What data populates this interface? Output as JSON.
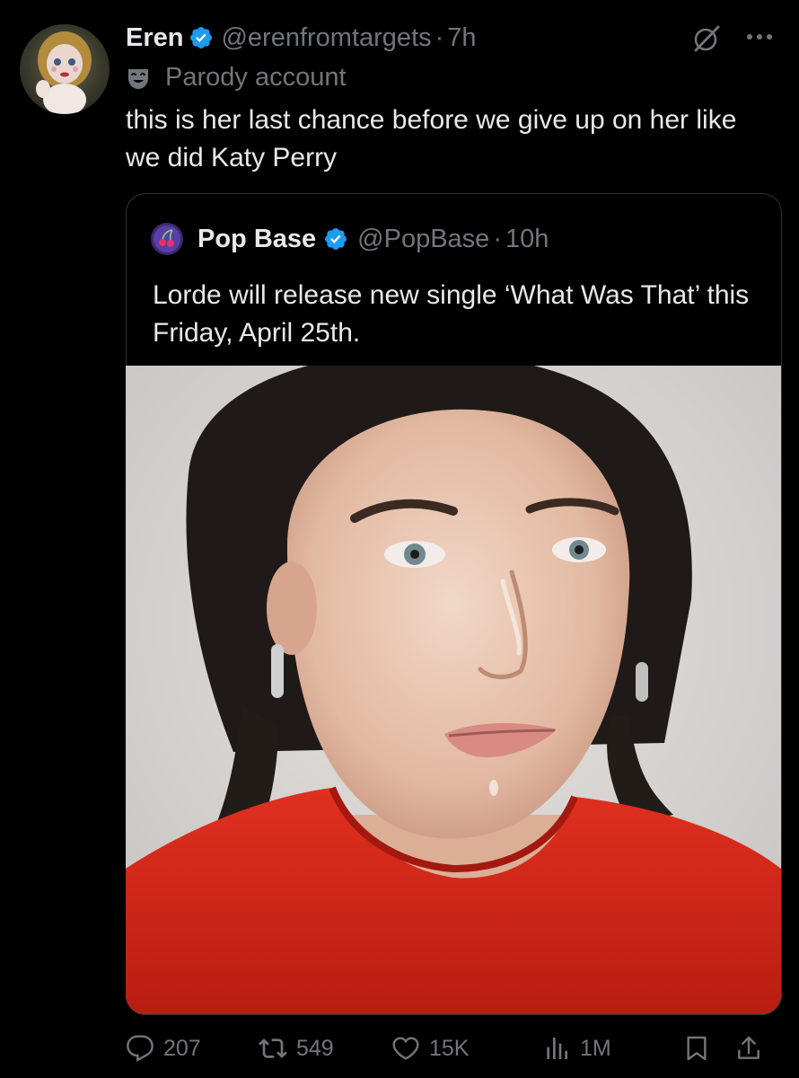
{
  "author": {
    "display_name": "Eren",
    "handle": "@erenfromtargets",
    "separator": "·",
    "time": "7h",
    "label": "Parody account"
  },
  "tweet": {
    "text": "this is her last chance before we give up on her like we did Katy Perry"
  },
  "quoted": {
    "display_name": "Pop Base",
    "handle": "@PopBase",
    "separator": "·",
    "time": "10h",
    "text": "Lorde will release new single ‘What Was That’ this Friday, April 25th."
  },
  "actions": {
    "replies": "207",
    "reposts": "549",
    "likes": "15K",
    "views": "1M"
  },
  "colors": {
    "background": "#000000",
    "text_primary": "#e7e9ea",
    "text_secondary": "#71767b",
    "verified_blue": "#1d9bf0",
    "border": "#2f3336",
    "shirt_red": "#d9261c"
  },
  "icons": [
    "verified-badge-icon",
    "grok-icon",
    "more-icon",
    "parody-mask-icon",
    "reply-icon",
    "repost-icon",
    "like-icon",
    "views-icon",
    "bookmark-icon",
    "share-icon"
  ]
}
